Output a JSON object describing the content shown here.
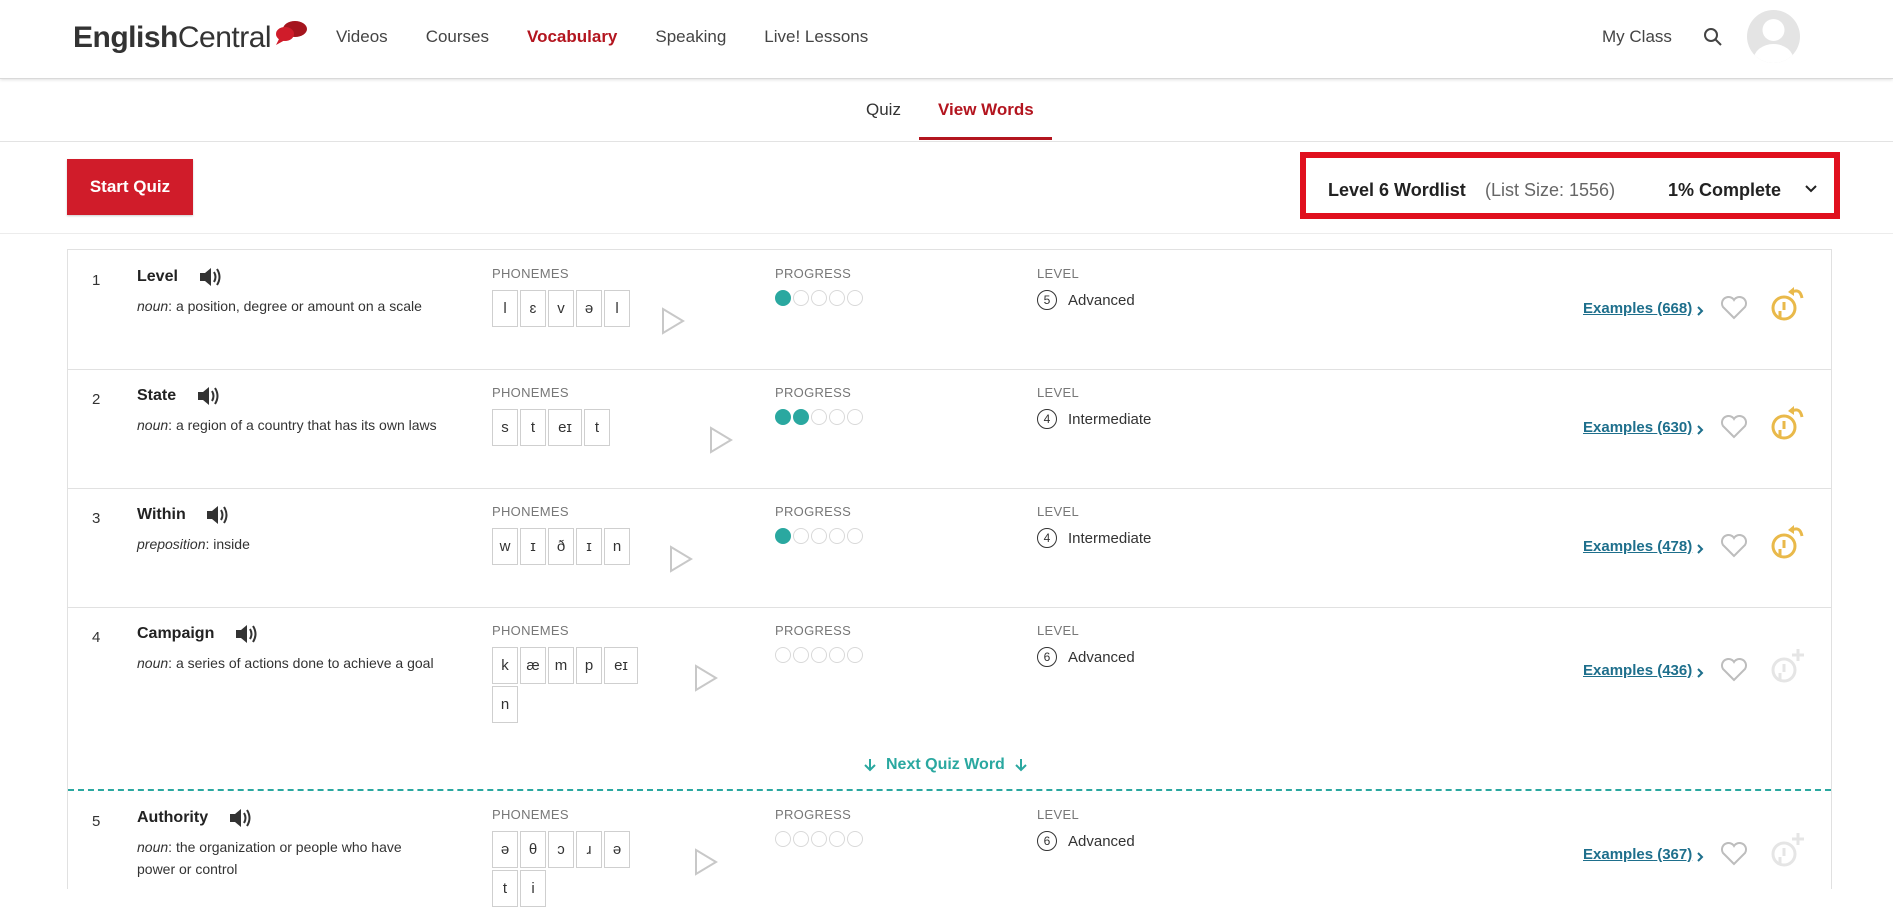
{
  "header": {
    "logo": {
      "part1": "English",
      "part2": "Central"
    },
    "nav": [
      "Videos",
      "Courses",
      "Vocabulary",
      "Speaking",
      "Live! Lessons"
    ],
    "active_nav": "Vocabulary",
    "my_class": "My Class"
  },
  "subtabs": {
    "quiz": "Quiz",
    "view_words": "View Words",
    "active": "View Words"
  },
  "controls": {
    "start_quiz": "Start Quiz",
    "wordlist_title": "Level 6 Wordlist",
    "list_size": "(List Size: 1556)",
    "complete": "1% Complete"
  },
  "columns": {
    "phonemes": "PHONEMES",
    "progress": "PROGRESS",
    "level": "LEVEL"
  },
  "next_quiz_word": "Next Quiz Word",
  "words": [
    {
      "num": "1",
      "word": "Level",
      "pos": "noun",
      "definition": "a position, degree or amount on a scale",
      "phonemes": [
        "l",
        "ɛ",
        "v",
        "ə",
        "l"
      ],
      "progress": 1,
      "level_num": "5",
      "level": "Advanced",
      "examples_label": "Examples",
      "examples_count": "(668)",
      "status": "learned"
    },
    {
      "num": "2",
      "word": "State",
      "pos": "noun",
      "definition": "a region of a country that has its own laws",
      "phonemes": [
        "s",
        "t",
        "eɪ",
        "t"
      ],
      "progress": 2,
      "level_num": "4",
      "level": "Intermediate",
      "examples_label": "Examples",
      "examples_count": "(630)",
      "status": "learned"
    },
    {
      "num": "3",
      "word": "Within",
      "pos": "preposition",
      "definition": "inside",
      "phonemes": [
        "w",
        "ɪ",
        "ð",
        "ɪ",
        "n"
      ],
      "progress": 1,
      "level_num": "4",
      "level": "Intermediate",
      "examples_label": "Examples",
      "examples_count": "(478)",
      "status": "learned"
    },
    {
      "num": "4",
      "word": "Campaign",
      "pos": "noun",
      "definition": "a series of actions done to achieve a goal",
      "phonemes": [
        "k",
        "æ",
        "m",
        "p",
        "eɪ",
        "n"
      ],
      "progress": 0,
      "level_num": "6",
      "level": "Advanced",
      "examples_label": "Examples",
      "examples_count": "(436)",
      "status": "new"
    },
    {
      "num": "5",
      "word": "Authority",
      "pos": "noun",
      "definition": "the organization or people who have power or control",
      "phonemes": [
        "ə",
        "θ",
        "ɔ",
        "ɹ",
        "ə",
        "t",
        "i"
      ],
      "progress": 0,
      "level_num": "6",
      "level": "Advanced",
      "examples_label": "Examples",
      "examples_count": "(367)",
      "status": "new"
    }
  ],
  "colors": {
    "brand_red": "#d01c2a",
    "active_red": "#b3151f",
    "teal": "#2aa8a0",
    "link_blue": "#1e6f8c",
    "gold": "#e9b94a"
  }
}
